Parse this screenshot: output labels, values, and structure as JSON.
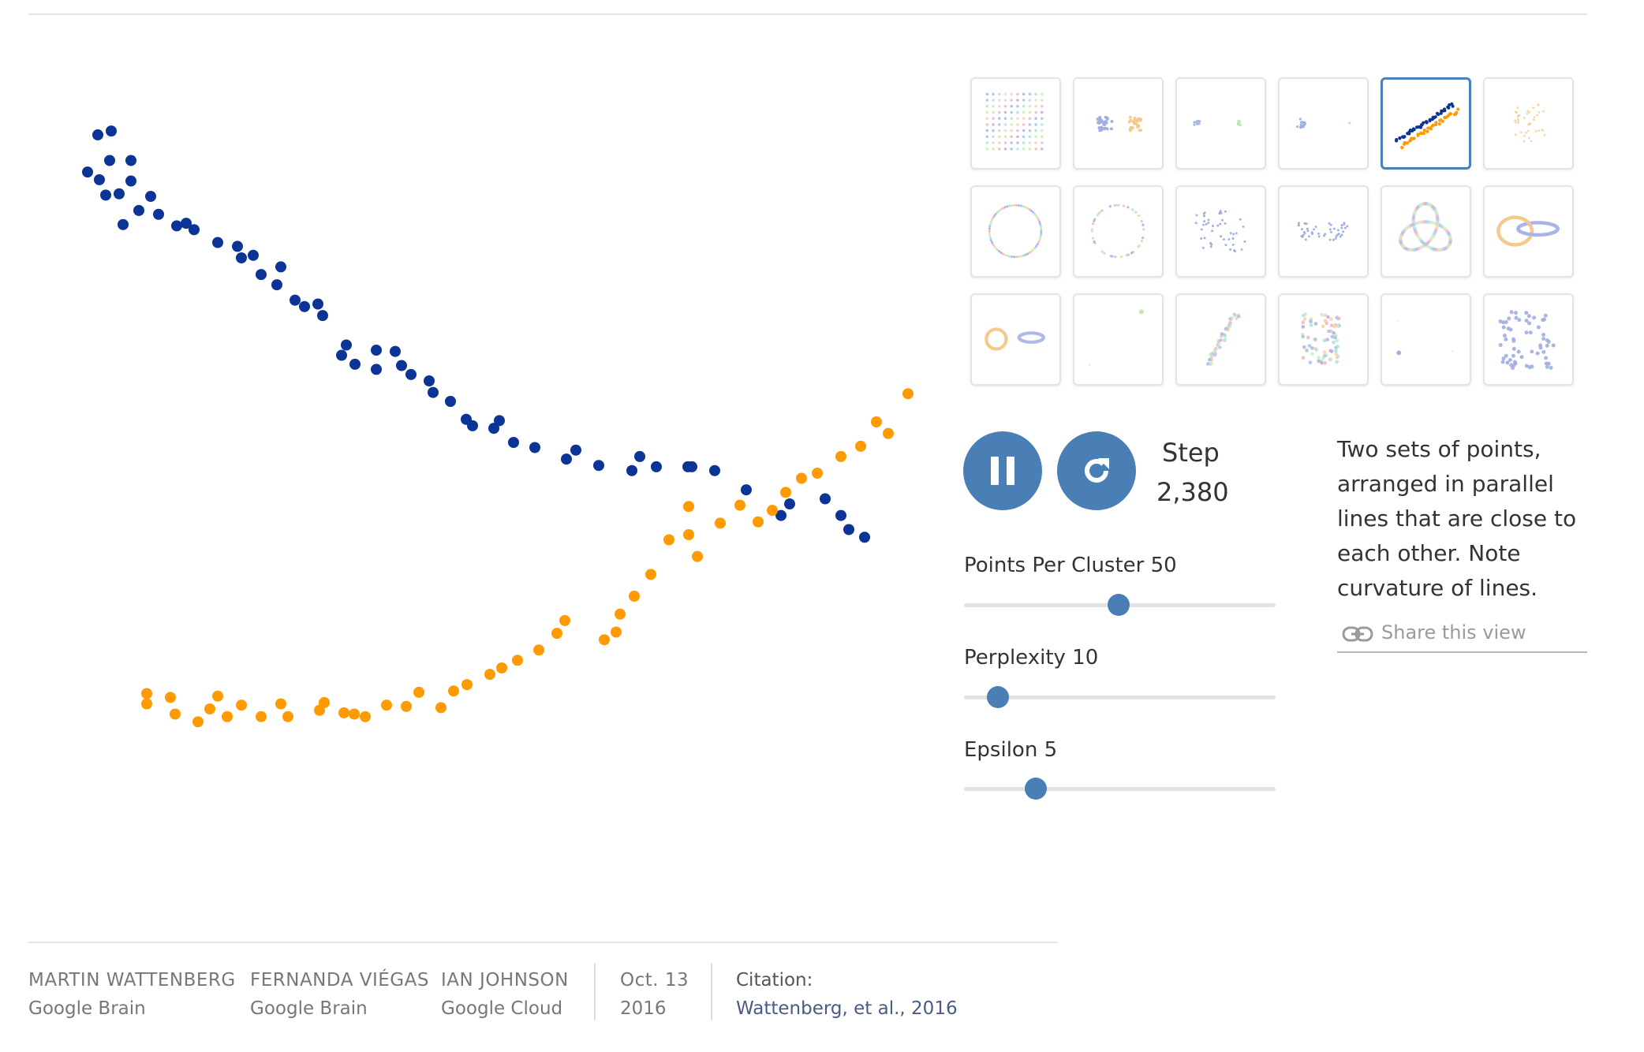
{
  "controls": {
    "pause_icon": "pause-icon",
    "restart_icon": "restart-icon",
    "step_label": "Step",
    "step_value": "2,380"
  },
  "sliders": [
    {
      "label": "Points Per Cluster 50",
      "value": 50,
      "fraction": 0.495
    },
    {
      "label": "Perplexity 10",
      "value": 10,
      "fraction": 0.11
    },
    {
      "label": "Epsilon 5",
      "value": 5,
      "fraction": 0.23
    }
  ],
  "description": "Two sets of points, arranged in parallel lines that are close to each other. Note curvature of lines.",
  "share": {
    "label": "Share this view",
    "icon": "link-icon"
  },
  "thumbnails": {
    "selected_index": 4,
    "count": 18
  },
  "colors": {
    "accent": "#4a7fb5",
    "series_a": "#0b3496",
    "series_b": "#ff9a00"
  },
  "footer": {
    "authors": [
      {
        "name": "MARTIN WATTENBERG",
        "affiliation": "Google Brain"
      },
      {
        "name": "FERNANDA VIÉGAS",
        "affiliation": "Google Brain"
      },
      {
        "name": "IAN JOHNSON",
        "affiliation": "Google Cloud"
      }
    ],
    "date_line1": "Oct. 13",
    "date_line2": "2016",
    "citation_label": "Citation:",
    "citation_text": "Wattenberg, et al., 2016"
  },
  "chart_data": {
    "type": "scatter",
    "series": [
      {
        "color": "#0b3496",
        "points": [
          [
            45,
            555
          ],
          [
            60,
            549
          ],
          [
            58,
            584
          ],
          [
            68,
            537
          ],
          [
            73,
            564
          ],
          [
            75,
            587
          ],
          [
            85,
            538
          ],
          [
            100,
            548
          ],
          [
            90,
            514
          ],
          [
            100,
            564
          ],
          [
            110,
            525
          ],
          [
            125,
            536
          ],
          [
            135,
            522
          ],
          [
            158,
            513
          ],
          [
            170,
            515
          ],
          [
            180,
            510
          ],
          [
            210,
            500
          ],
          [
            235,
            497
          ],
          [
            240,
            488
          ],
          [
            255,
            490
          ],
          [
            265,
            475
          ],
          [
            285,
            467
          ],
          [
            290,
            481
          ],
          [
            308,
            455
          ],
          [
            320,
            450
          ],
          [
            337,
            452
          ],
          [
            343,
            443
          ],
          [
            367,
            412
          ],
          [
            373,
            420
          ],
          [
            384,
            405
          ],
          [
            411,
            401
          ],
          [
            411,
            416
          ],
          [
            435,
            415
          ],
          [
            443,
            404
          ],
          [
            455,
            397
          ],
          [
            483,
            383
          ],
          [
            478,
            392
          ],
          [
            505,
            376
          ],
          [
            525,
            362
          ],
          [
            533,
            357
          ],
          [
            560,
            355
          ],
          [
            567,
            361
          ],
          [
            585,
            344
          ],
          [
            612,
            340
          ],
          [
            652,
            331
          ],
          [
            664,
            338
          ],
          [
            693,
            326
          ],
          [
            735,
            322
          ],
          [
            745,
            333
          ],
          [
            766,
            325
          ],
          [
            806,
            325
          ],
          [
            811,
            325
          ],
          [
            840,
            322
          ],
          [
            880,
            307
          ],
          [
            924,
            287
          ],
          [
            935,
            296
          ],
          [
            980,
            300
          ],
          [
            1000,
            287
          ],
          [
            1010,
            276
          ],
          [
            1030,
            270
          ]
        ]
      },
      {
        "color": "#ff9a00",
        "points": [
          [
            120,
            148
          ],
          [
            120,
            140
          ],
          [
            150,
            145
          ],
          [
            156,
            132
          ],
          [
            185,
            126
          ],
          [
            200,
            136
          ],
          [
            210,
            146
          ],
          [
            222,
            130
          ],
          [
            240,
            139
          ],
          [
            265,
            130
          ],
          [
            290,
            140
          ],
          [
            299,
            130
          ],
          [
            339,
            135
          ],
          [
            345,
            141
          ],
          [
            370,
            133
          ],
          [
            383,
            132
          ],
          [
            397,
            130
          ],
          [
            424,
            139
          ],
          [
            449,
            138
          ],
          [
            465,
            149
          ],
          [
            493,
            137
          ],
          [
            509,
            150
          ],
          [
            526,
            155
          ],
          [
            555,
            163
          ],
          [
            570,
            168
          ],
          [
            590,
            174
          ],
          [
            617,
            182
          ],
          [
            640,
            195
          ],
          [
            650,
            205
          ],
          [
            700,
            190
          ],
          [
            715,
            196
          ],
          [
            720,
            210
          ],
          [
            738,
            224
          ],
          [
            759,
            241
          ],
          [
            782,
            268
          ],
          [
            807,
            272
          ],
          [
            807,
            294
          ],
          [
            818,
            255
          ],
          [
            847,
            281
          ],
          [
            872,
            295
          ],
          [
            895,
            282
          ],
          [
            913,
            291
          ],
          [
            930,
            305
          ],
          [
            950,
            316
          ],
          [
            970,
            320
          ],
          [
            1000,
            333
          ],
          [
            1025,
            341
          ],
          [
            1045,
            360
          ],
          [
            1060,
            351
          ],
          [
            1085,
            382
          ]
        ]
      }
    ],
    "xlim": [
      0,
      1100
    ],
    "ylim": [
      0,
      640
    ]
  }
}
